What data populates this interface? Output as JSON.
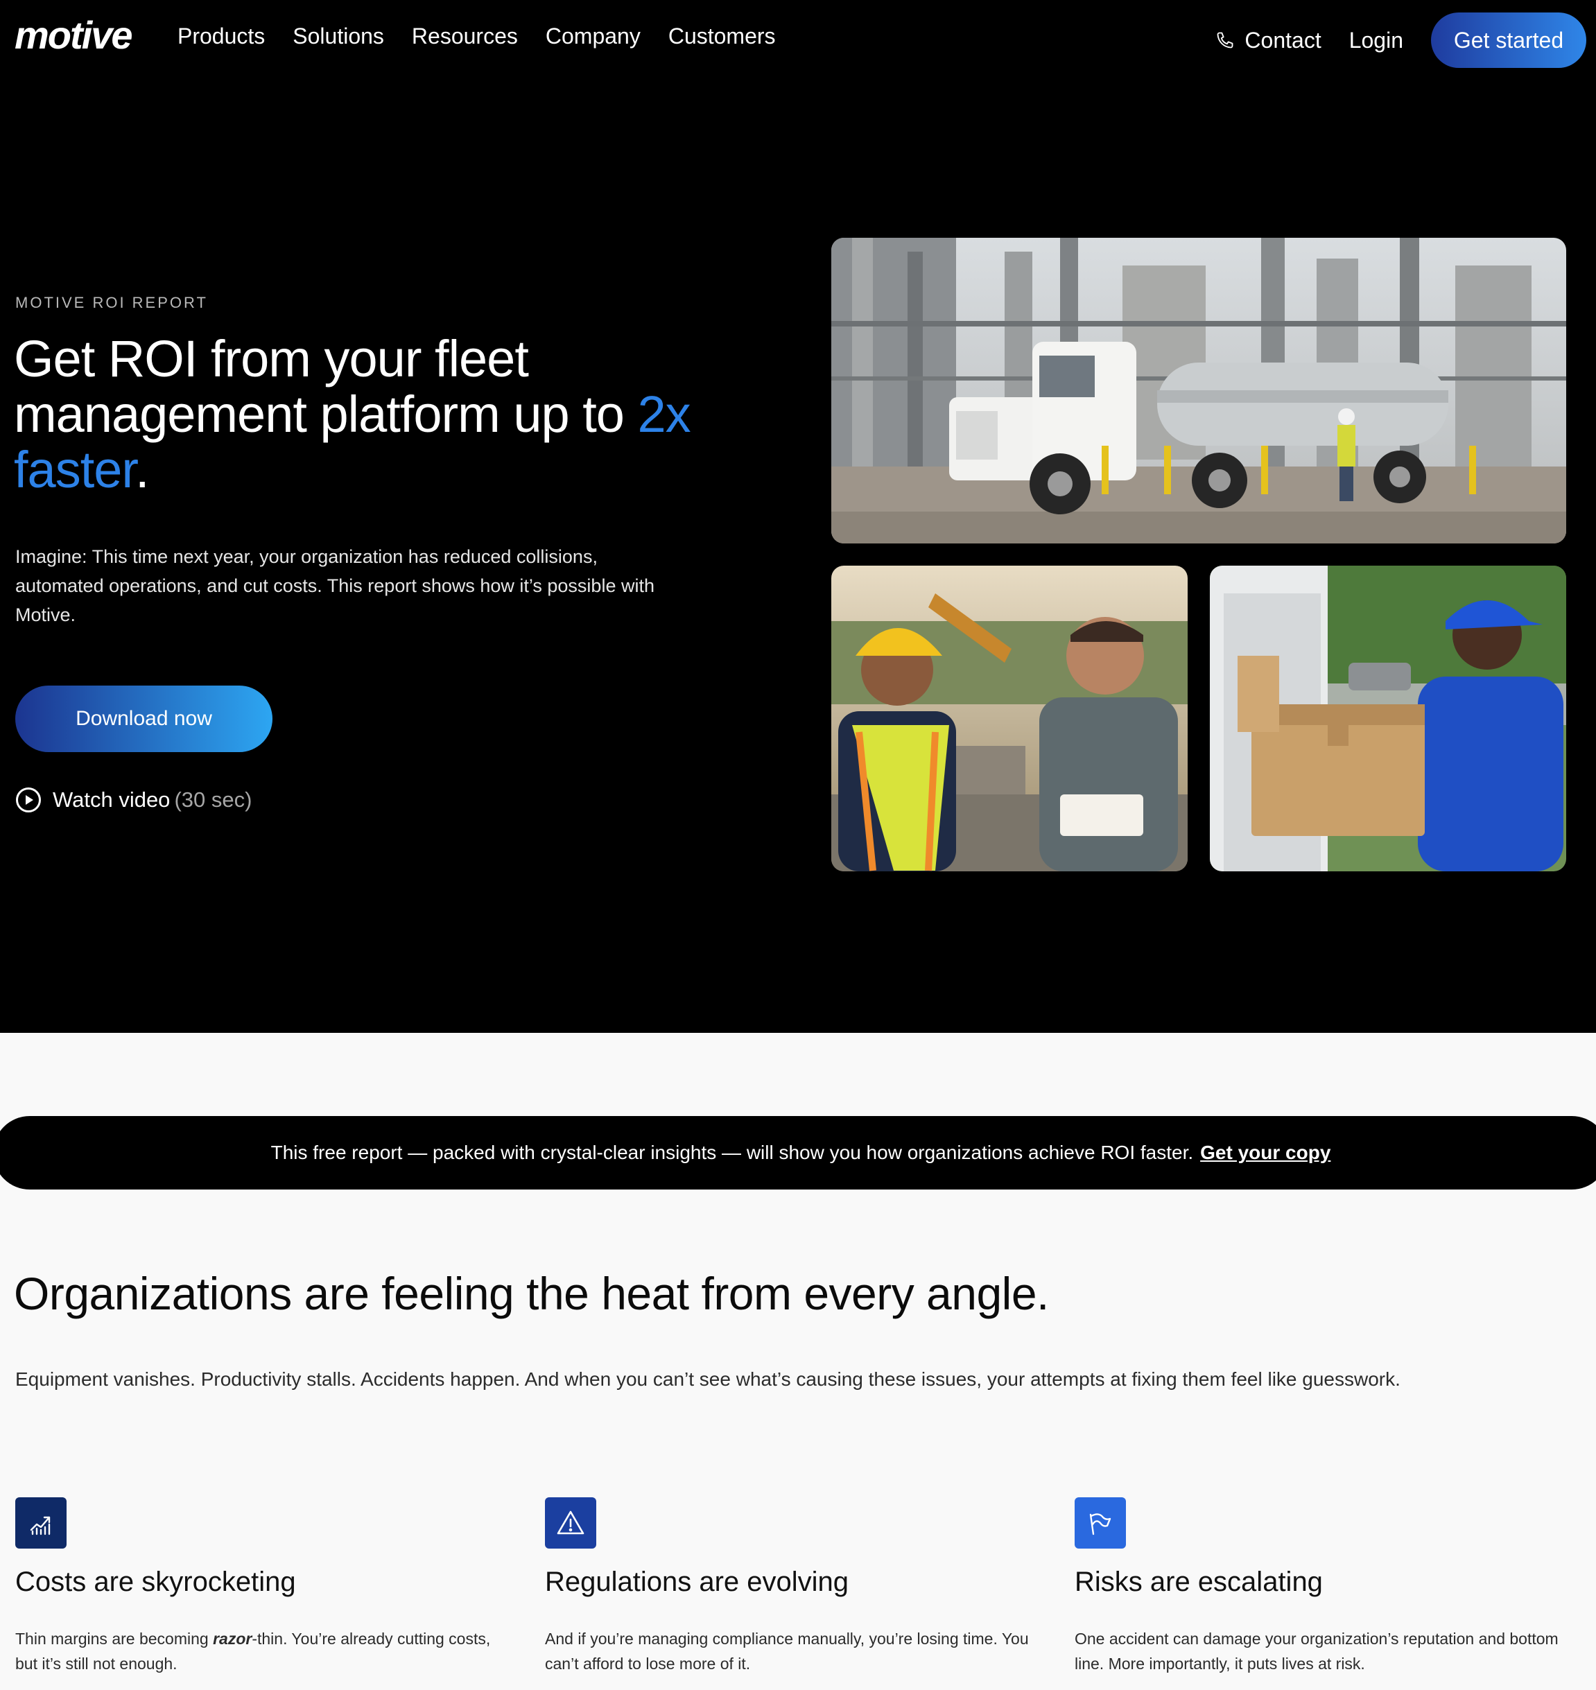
{
  "nav": {
    "logo": "motive",
    "links": [
      "Products",
      "Solutions",
      "Resources",
      "Company",
      "Customers"
    ],
    "contact": "Contact",
    "login": "Login",
    "cta": "Get started"
  },
  "hero": {
    "eyebrow": "MOTIVE ROI REPORT",
    "headline_main": "Get ROI from your fleet management platform up to ",
    "headline_highlight": "2x faster",
    "headline_end": ".",
    "intro": "Imagine: This time next year, your organization has reduced collisions, automated operations, and cut costs. This report shows how it’s possible with Motive.",
    "download": "Download now",
    "watch_label": "Watch video",
    "watch_duration": "(30 sec)"
  },
  "banner": {
    "text": "This free report — packed with crystal-clear insights — will show you how organizations achieve ROI faster.",
    "link": "Get your copy"
  },
  "section": {
    "title": "Organizations are feeling the heat from every angle.",
    "subtitle": "Equipment vanishes. Productivity stalls. Accidents happen. And when you can’t see what’s causing these issues, your attempts at fixing them feel like guesswork."
  },
  "features": [
    {
      "icon": "chart-up-icon",
      "title": "Costs are skyrocketing",
      "text_before": "Thin margins are becoming ",
      "text_em": "razor",
      "text_after": "-thin. You’re already cutting costs, but it’s still not enough."
    },
    {
      "icon": "warning-icon",
      "title": "Regulations are evolving",
      "text": "And if you’re managing compliance manually, you’re losing time. You can’t afford to lose more of it."
    },
    {
      "icon": "flag-icon",
      "title": "Risks are escalating",
      "text": "One accident can damage your organization’s reputation and bottom line. More importantly, it puts lives at risk."
    }
  ],
  "colors": {
    "accent_blue": "#2d82e8",
    "hero_bg": "#000000",
    "page_bg": "#f9f9f9"
  }
}
